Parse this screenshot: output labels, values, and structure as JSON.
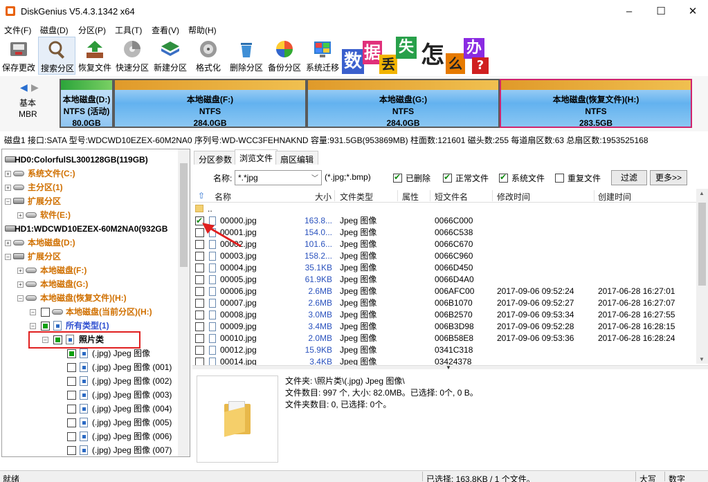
{
  "window": {
    "title": "DiskGenius V5.4.3.1342 x64",
    "minimize": "–",
    "maximize": "☐",
    "close": "✕"
  },
  "menu": [
    "文件(F)",
    "磁盘(D)",
    "分区(P)",
    "工具(T)",
    "查看(V)",
    "帮助(H)"
  ],
  "toolbar": [
    {
      "label": "保存更改",
      "icon": "save-disk-icon"
    },
    {
      "label": "搜索分区",
      "icon": "search-partition-icon"
    },
    {
      "label": "恢复文件",
      "icon": "recover-file-icon"
    },
    {
      "label": "快速分区",
      "icon": "quick-partition-icon"
    },
    {
      "label": "新建分区",
      "icon": "new-partition-icon"
    },
    {
      "label": "格式化",
      "icon": "format-icon"
    },
    {
      "label": "删除分区",
      "icon": "delete-partition-icon"
    },
    {
      "label": "备份分区",
      "icon": "backup-partition-icon"
    },
    {
      "label": "系统迁移",
      "icon": "system-migrate-icon"
    }
  ],
  "banner": {
    "chars": [
      "数",
      "据",
      "丢",
      "失",
      "怎",
      "么",
      "办",
      "?"
    ],
    "colors": [
      "#3a5fcd",
      "#e0307a",
      "#f2b400",
      "#28a04a",
      "#2a2a2a",
      "#e67a00",
      "#8a2be2",
      "#d02020"
    ]
  },
  "diskmap": {
    "nav_left": "◀",
    "nav_right": "▶",
    "type": "基本",
    "scheme": "MBR",
    "partitions": [
      {
        "name": "本地磁盘(D:)",
        "fs": "NTFS (活动)",
        "size": "80.0GB"
      },
      {
        "name": "本地磁盘(F:)",
        "fs": "NTFS",
        "size": "284.0GB"
      },
      {
        "name": "本地磁盘(G:)",
        "fs": "NTFS",
        "size": "284.0GB"
      },
      {
        "name": "本地磁盘(恢复文件)(H:)",
        "fs": "NTFS",
        "size": "283.5GB"
      }
    ]
  },
  "infobar": "磁盘1 接口:SATA  型号:WDCWD10EZEX-60M2NA0  序列号:WD-WCC3FEHNAKND  容量:931.5GB(953869MB)  柱面数:121601  磁头数:255  每道扇区数:63  总扇区数:1953525168",
  "tree": [
    {
      "label": "HD0:ColorfulSL300128GB(119GB)",
      "style": "bold"
    },
    {
      "label": "系统文件(C:)",
      "style": "orange"
    },
    {
      "label": "主分区(1)",
      "style": "orange"
    },
    {
      "label": "扩展分区",
      "style": "orange"
    },
    {
      "label": "软件(E:)",
      "style": "orange"
    },
    {
      "label": "HD1:WDCWD10EZEX-60M2NA0(932GB",
      "style": "bold"
    },
    {
      "label": "本地磁盘(D:)",
      "style": "orange"
    },
    {
      "label": "扩展分区",
      "style": "orange"
    },
    {
      "label": "本地磁盘(F:)",
      "style": "orange"
    },
    {
      "label": "本地磁盘(G:)",
      "style": "orange"
    },
    {
      "label": "本地磁盘(恢复文件)(H:)",
      "style": "orange"
    },
    {
      "label": "本地磁盘(当前分区)(H:)",
      "style": "orange"
    },
    {
      "label": "所有类型(1)",
      "style": "blue"
    },
    {
      "label": "照片类",
      "style": "bold"
    },
    {
      "label": "(.jpg) Jpeg 图像",
      "style": "normal"
    },
    {
      "label": "(.jpg) Jpeg 图像 (001)",
      "style": "normal"
    },
    {
      "label": "(.jpg) Jpeg 图像 (002)",
      "style": "normal"
    },
    {
      "label": "(.jpg) Jpeg 图像 (003)",
      "style": "normal"
    },
    {
      "label": "(.jpg) Jpeg 图像 (004)",
      "style": "normal"
    },
    {
      "label": "(.jpg) Jpeg 图像 (005)",
      "style": "normal"
    },
    {
      "label": "(.jpg) Jpeg 图像 (006)",
      "style": "normal"
    },
    {
      "label": "(.jpg) Jpeg 图像 (007)",
      "style": "normal"
    }
  ],
  "tabs": [
    "分区参数",
    "浏览文件",
    "扇区编辑"
  ],
  "filter": {
    "name_label": "名称:",
    "name_value": "*.*jpg",
    "hint": "(*.jpg;*.bmp)",
    "deleted": "已删除",
    "normal": "正常文件",
    "system": "系统文件",
    "duplicate": "重复文件",
    "filter_btn": "过滤",
    "more_btn": "更多>>"
  },
  "columns": [
    "名称",
    "大小",
    "文件类型",
    "属性",
    "短文件名",
    "修改时间",
    "创建时间"
  ],
  "parent_row": "..",
  "files": [
    {
      "name": "00000.jpg",
      "size": "163.8...",
      "type": "Jpeg 图像",
      "short": "0066C000",
      "mtime": "",
      "ctime": "",
      "checked": true
    },
    {
      "name": "00001.jpg",
      "size": "154.0...",
      "type": "Jpeg 图像",
      "short": "0066C538",
      "mtime": "",
      "ctime": "",
      "checked": false
    },
    {
      "name": "00002.jpg",
      "size": "101.6...",
      "type": "Jpeg 图像",
      "short": "0066C670",
      "mtime": "",
      "ctime": "",
      "checked": false
    },
    {
      "name": "00003.jpg",
      "size": "158.2...",
      "type": "Jpeg 图像",
      "short": "0066C960",
      "mtime": "",
      "ctime": "",
      "checked": false
    },
    {
      "name": "00004.jpg",
      "size": "35.1KB",
      "type": "Jpeg 图像",
      "short": "0066D450",
      "mtime": "",
      "ctime": "",
      "checked": false
    },
    {
      "name": "00005.jpg",
      "size": "61.9KB",
      "type": "Jpeg 图像",
      "short": "0066D4A0",
      "mtime": "",
      "ctime": "",
      "checked": false
    },
    {
      "name": "00006.jpg",
      "size": "2.6MB",
      "type": "Jpeg 图像",
      "short": "006AFC00",
      "mtime": "2017-09-06 09:52:24",
      "ctime": "2017-06-28 16:27:01",
      "checked": false
    },
    {
      "name": "00007.jpg",
      "size": "2.6MB",
      "type": "Jpeg 图像",
      "short": "006B1070",
      "mtime": "2017-09-06 09:52:27",
      "ctime": "2017-06-28 16:27:07",
      "checked": false
    },
    {
      "name": "00008.jpg",
      "size": "3.0MB",
      "type": "Jpeg 图像",
      "short": "006B2570",
      "mtime": "2017-09-06 09:53:34",
      "ctime": "2017-06-28 16:27:55",
      "checked": false
    },
    {
      "name": "00009.jpg",
      "size": "3.4MB",
      "type": "Jpeg 图像",
      "short": "006B3D98",
      "mtime": "2017-09-06 09:52:28",
      "ctime": "2017-06-28 16:28:15",
      "checked": false
    },
    {
      "name": "00010.jpg",
      "size": "2.0MB",
      "type": "Jpeg 图像",
      "short": "006B58E8",
      "mtime": "2017-09-06 09:53:36",
      "ctime": "2017-06-28 16:28:24",
      "checked": false
    },
    {
      "name": "00012.jpg",
      "size": "15.9KB",
      "type": "Jpeg 图像",
      "short": "0341C318",
      "mtime": "",
      "ctime": "",
      "checked": false
    },
    {
      "name": "00014.jpg",
      "size": "3.4KB",
      "type": "Jpeg 图像",
      "short": "03424378",
      "mtime": "",
      "ctime": "",
      "checked": false
    }
  ],
  "details": {
    "folder": "文件夹: \\照片类\\(.jpg) Jpeg 图像\\",
    "count": "文件数目: 997 个, 大小: 82.0MB。已选择: 0个, 0 B。",
    "subfolders": "文件夹数目: 0, 已选择: 0个。"
  },
  "status": {
    "left": "就绪",
    "selected": "已选择: 163.8KB / 1 个文件。",
    "caps": "大写",
    "num": "数字"
  }
}
